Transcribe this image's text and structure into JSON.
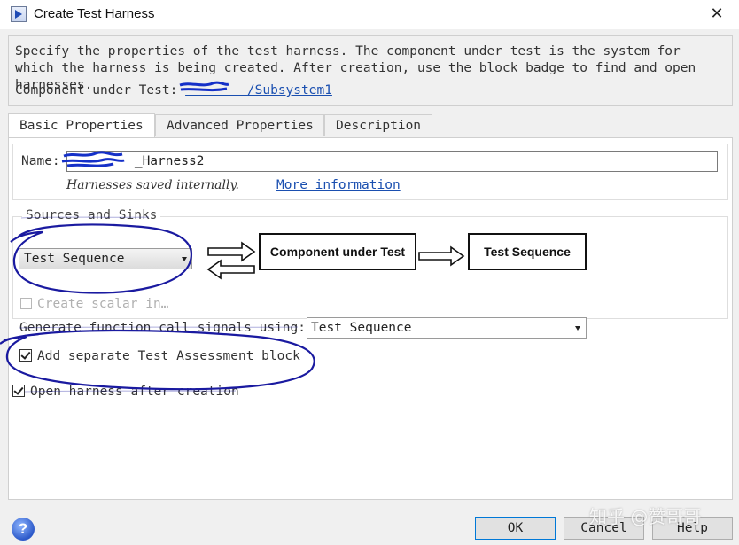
{
  "window": {
    "title": "Create Test Harness"
  },
  "info": {
    "description": "Specify the properties of the test harness. The component under test is the system for which the harness is being created. After creation, use the block badge to find and open harnesses.",
    "cut_label": "Component under Test:",
    "cut_path": "        /Subsystem1"
  },
  "tabs": [
    {
      "label": "Basic Properties",
      "active": true
    },
    {
      "label": "Advanced Properties",
      "active": false
    },
    {
      "label": "Description",
      "active": false
    }
  ],
  "basic": {
    "name_label": "Name:",
    "name_value": "        _Harness2",
    "saved_note": "Harnesses saved internally.",
    "more_info": "More information",
    "sources_sinks_title": "Sources and Sinks",
    "source_value": "Test Sequence",
    "block_cut": "Component under Test",
    "block_sink": "Test Sequence",
    "scalar_label": "Create scalar in…",
    "fcall_label": "Generate function call signals using:",
    "fcall_value": "Test Sequence",
    "add_assessment": "Add separate Test Assessment block",
    "open_after": "Open harness after creation"
  },
  "buttons": {
    "ok": "OK",
    "cancel": "Cancel",
    "help": "Help"
  },
  "watermark": "知乎 @赞哥哥"
}
